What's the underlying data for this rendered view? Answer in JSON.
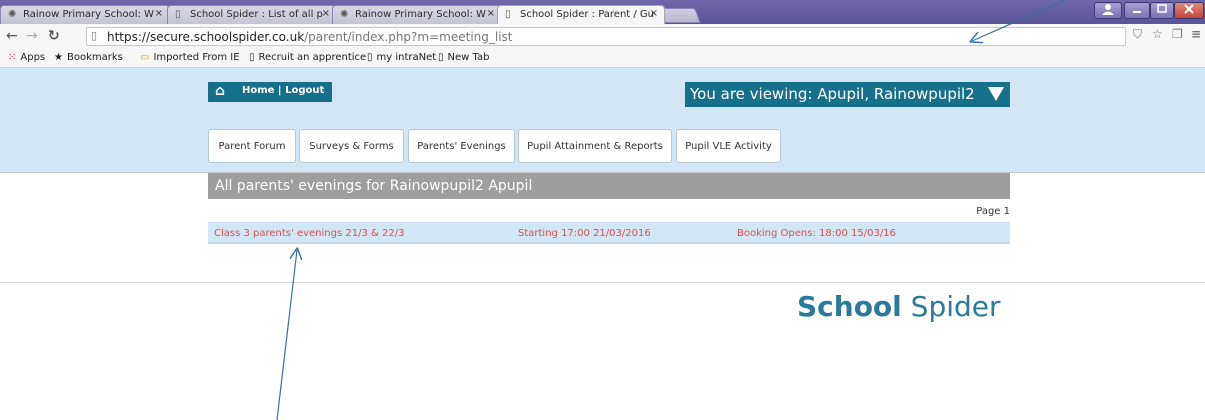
{
  "browser": {
    "tabs": [
      {
        "title": "Rainow Primary School: W",
        "icon": "spider-icon",
        "active": false
      },
      {
        "title": "School Spider : List of all p",
        "icon": "page-icon",
        "active": false
      },
      {
        "title": "Rainow Primary School: W",
        "icon": "spider-icon",
        "active": false
      },
      {
        "title": "School Spider : Parent / Gu",
        "icon": "page-icon",
        "active": true
      }
    ],
    "tab_close": "×",
    "url_host": "https://secure.schoolspider.co.uk",
    "url_path": "/parent/index.php?m=meeting_list",
    "bookmarks": [
      {
        "label": "Apps",
        "icon": "apps-grid-icon"
      },
      {
        "label": "Bookmarks",
        "icon": "star-icon"
      },
      {
        "label": "Imported From IE",
        "icon": "folder-icon"
      },
      {
        "label": "Recruit an apprentice",
        "icon": "page-icon"
      },
      {
        "label": "my intraNet",
        "icon": "page-icon"
      },
      {
        "label": "New Tab",
        "icon": "page-icon"
      }
    ]
  },
  "header": {
    "home_label": "Home",
    "separator": " | ",
    "logout_label": "Logout",
    "viewing_label": "You are viewing: Apupil, Rainowpupil2"
  },
  "nav_tabs": [
    {
      "label": "Parent Forum"
    },
    {
      "label": "Surveys & Forms"
    },
    {
      "label": "Parents' Evenings"
    },
    {
      "label": "Pupil Attainment & Reports"
    },
    {
      "label": "Pupil VLE Activity"
    }
  ],
  "main": {
    "title": "All parents' evenings for Rainowpupil2 Apupil",
    "page_label": "Page 1",
    "meetings": [
      {
        "name": "Class 3 parents' evenings 21/3 & 22/3",
        "starting": "Starting 17:00 21/03/2016",
        "booking": "Booking Opens: 18:00 15/03/16"
      }
    ]
  },
  "logo": {
    "bold": "School",
    "light": " Spider"
  },
  "colors": {
    "brand_teal": "#17708a",
    "header_bg": "#d3e6f6",
    "link_red": "#d9534f",
    "title_gray": "#9e9e9e"
  }
}
